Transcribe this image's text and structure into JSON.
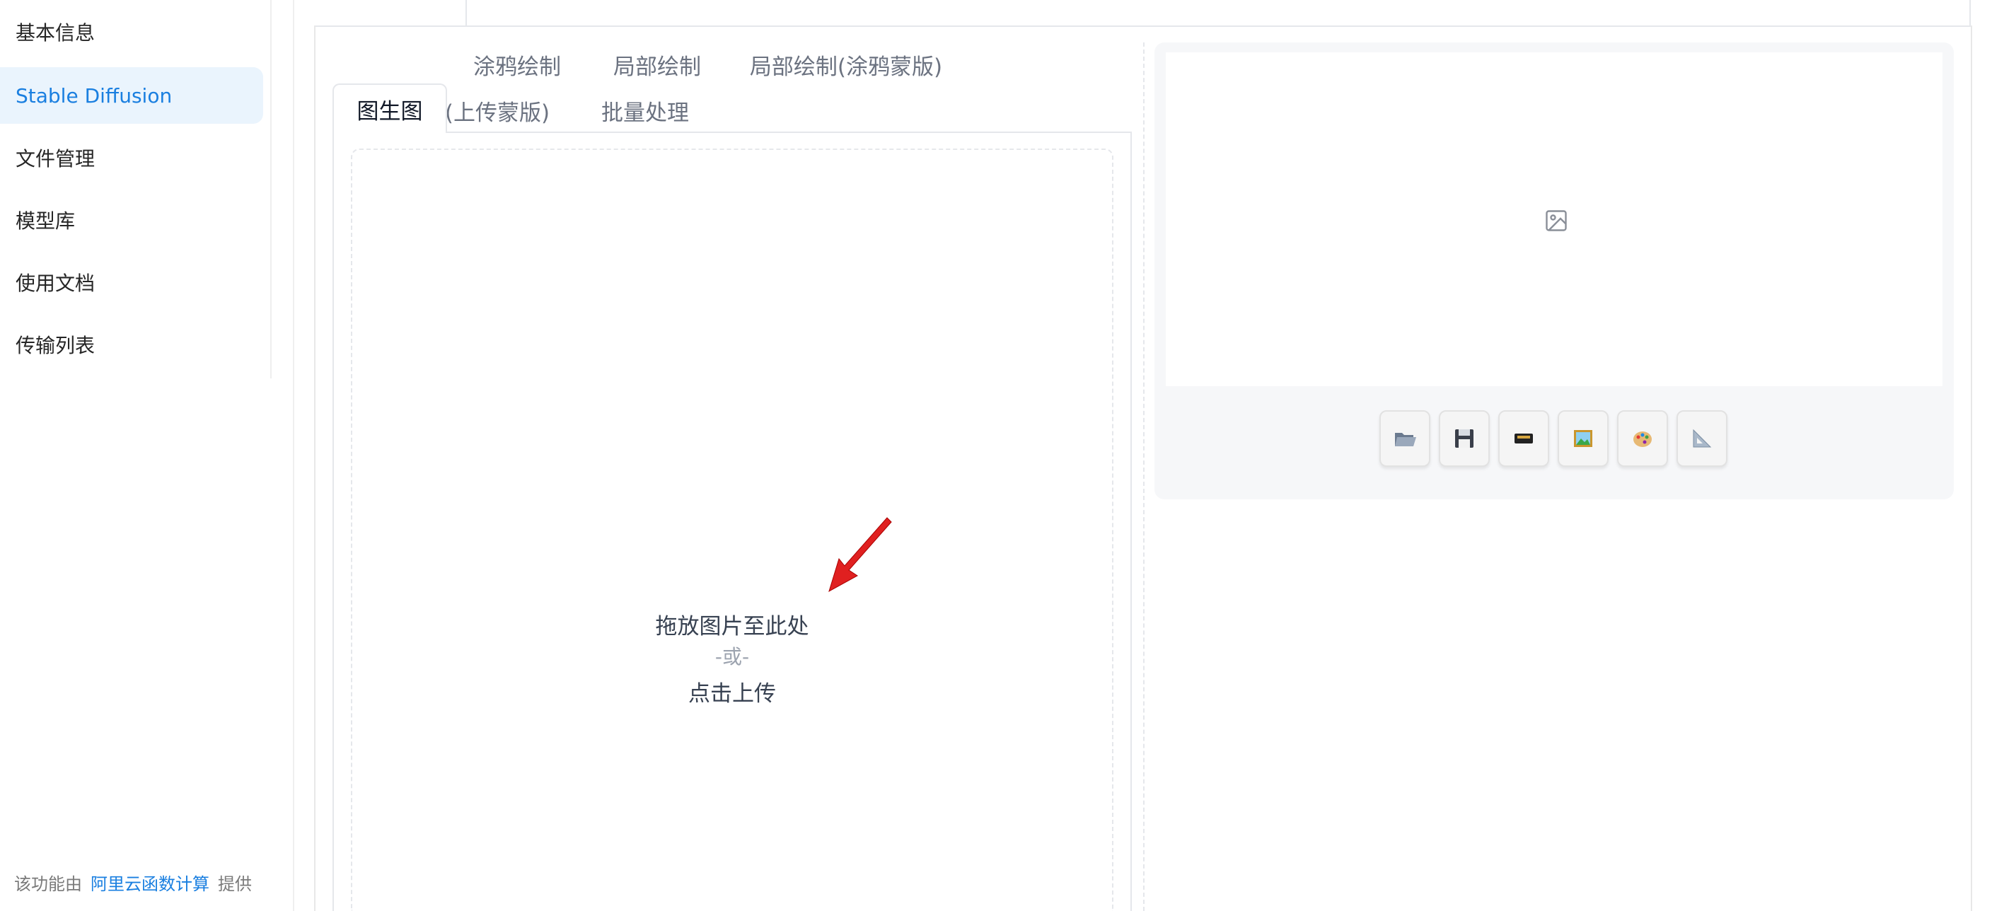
{
  "sidebar": {
    "items": [
      {
        "label": "基本信息",
        "active": false
      },
      {
        "label": "Stable Diffusion",
        "active": true
      },
      {
        "label": "文件管理",
        "active": false
      },
      {
        "label": "模型库",
        "active": false
      },
      {
        "label": "使用文档",
        "active": false
      },
      {
        "label": "传输列表",
        "active": false
      }
    ],
    "footer": {
      "prefix": "该功能由",
      "link": "阿里云函数计算",
      "suffix": "提供"
    }
  },
  "tabs": [
    {
      "label": "图生图",
      "active": true
    },
    {
      "label": "涂鸦绘制",
      "active": false
    },
    {
      "label": "局部绘制",
      "active": false
    },
    {
      "label": "局部绘制(涂鸦蒙版)",
      "active": false
    },
    {
      "label": "局部绘制(上传蒙版)",
      "active": false
    },
    {
      "label": "批量处理",
      "active": false
    }
  ],
  "upload": {
    "drop_text": "拖放图片至此处",
    "or_text": "-或-",
    "click_text": "点击上传"
  },
  "output": {
    "placeholder_icon": "image-icon",
    "tools": [
      {
        "icon": "folder-open-icon"
      },
      {
        "icon": "floppy-disk-icon"
      },
      {
        "icon": "file-cabinet-icon"
      },
      {
        "icon": "framed-picture-icon"
      },
      {
        "icon": "palette-icon"
      },
      {
        "icon": "triangular-ruler-icon"
      }
    ]
  },
  "colors": {
    "accent": "#1a7fe0",
    "active_nav_bg": "#eaf4fd",
    "arrow": "#e02020"
  }
}
